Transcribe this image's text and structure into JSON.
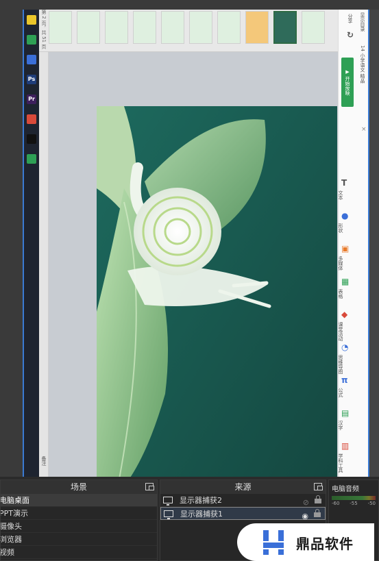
{
  "preview": {
    "taskbar_icons": [
      {
        "name": "notes-icon",
        "color": "#e9c52b",
        "glyph": ""
      },
      {
        "name": "wechat-icon",
        "color": "#2ea055",
        "glyph": ""
      },
      {
        "name": "browser-icon",
        "color": "#3b6fd8",
        "glyph": ""
      },
      {
        "name": "ps-icon",
        "color": "#1f3d7a",
        "glyph": "Ps"
      },
      {
        "name": "pr-icon",
        "color": "#3d1f5c",
        "glyph": "Pr"
      },
      {
        "name": "chrome-icon",
        "color": "#d94a3a",
        "glyph": ""
      },
      {
        "name": "obs-icon",
        "color": "#111111",
        "glyph": ""
      },
      {
        "name": "green-app-icon",
        "color": "#2ea055",
        "glyph": ""
      }
    ],
    "slide_counter": "第 2 页，共 51 页",
    "new_slide_label": "+ 新建页面",
    "thumbnails": [
      {
        "label": "",
        "selected": false
      },
      {
        "label": "",
        "selected": false
      },
      {
        "label": "",
        "selected": false
      },
      {
        "label": "",
        "selected": false
      },
      {
        "label": "",
        "selected": false
      },
      {
        "label": "",
        "selected": false
      },
      {
        "label": "",
        "selected": false
      },
      {
        "label": "",
        "selected": false
      },
      {
        "label": "",
        "selected": true
      },
      {
        "label": "",
        "selected": false
      }
    ],
    "left_bar_label": "备注",
    "right_panel": {
      "top_label": "显示目录",
      "share_label": "分享",
      "sync_label": "同步",
      "course_label": "14 小学语文 精品",
      "bg_button_label": "▶ 开始放映",
      "close_label": "×",
      "tools": [
        {
          "label": "文本",
          "icon": "T",
          "color": "#555555"
        },
        {
          "label": "形状",
          "icon": "●",
          "color": "#3b6fd8"
        },
        {
          "label": "多媒体",
          "icon": "▣",
          "color": "#e87a2a"
        },
        {
          "label": "表格",
          "icon": "▦",
          "color": "#2ea055"
        },
        {
          "label": "课堂活动",
          "icon": "◆",
          "color": "#d94a3a"
        },
        {
          "label": "思维导图",
          "icon": "◔",
          "color": "#3b6fd8"
        },
        {
          "label": "公式",
          "icon": "π",
          "color": "#3b6fd8"
        },
        {
          "label": "汉字",
          "icon": "▤",
          "color": "#2ea055"
        },
        {
          "label": "学科工具",
          "icon": "▥",
          "color": "#d94a3a"
        }
      ]
    }
  },
  "scenes_panel": {
    "title": "场景",
    "items": [
      {
        "label": "电脑桌面",
        "active": true
      },
      {
        "label": "PPT演示",
        "active": false
      },
      {
        "label": "摄像头",
        "active": false
      },
      {
        "label": "浏览器",
        "active": false
      },
      {
        "label": "视频",
        "active": false
      }
    ]
  },
  "sources_panel": {
    "title": "来源",
    "items": [
      {
        "label": "显示器捕获2",
        "visible": false,
        "selected": false
      },
      {
        "label": "显示器捕获1",
        "visible": true,
        "selected": true
      }
    ]
  },
  "audio_panel": {
    "channel_name": "电脑音频",
    "ticks": [
      "-60",
      "-55",
      "-50"
    ]
  },
  "watermark": {
    "text": "鼎品软件"
  }
}
